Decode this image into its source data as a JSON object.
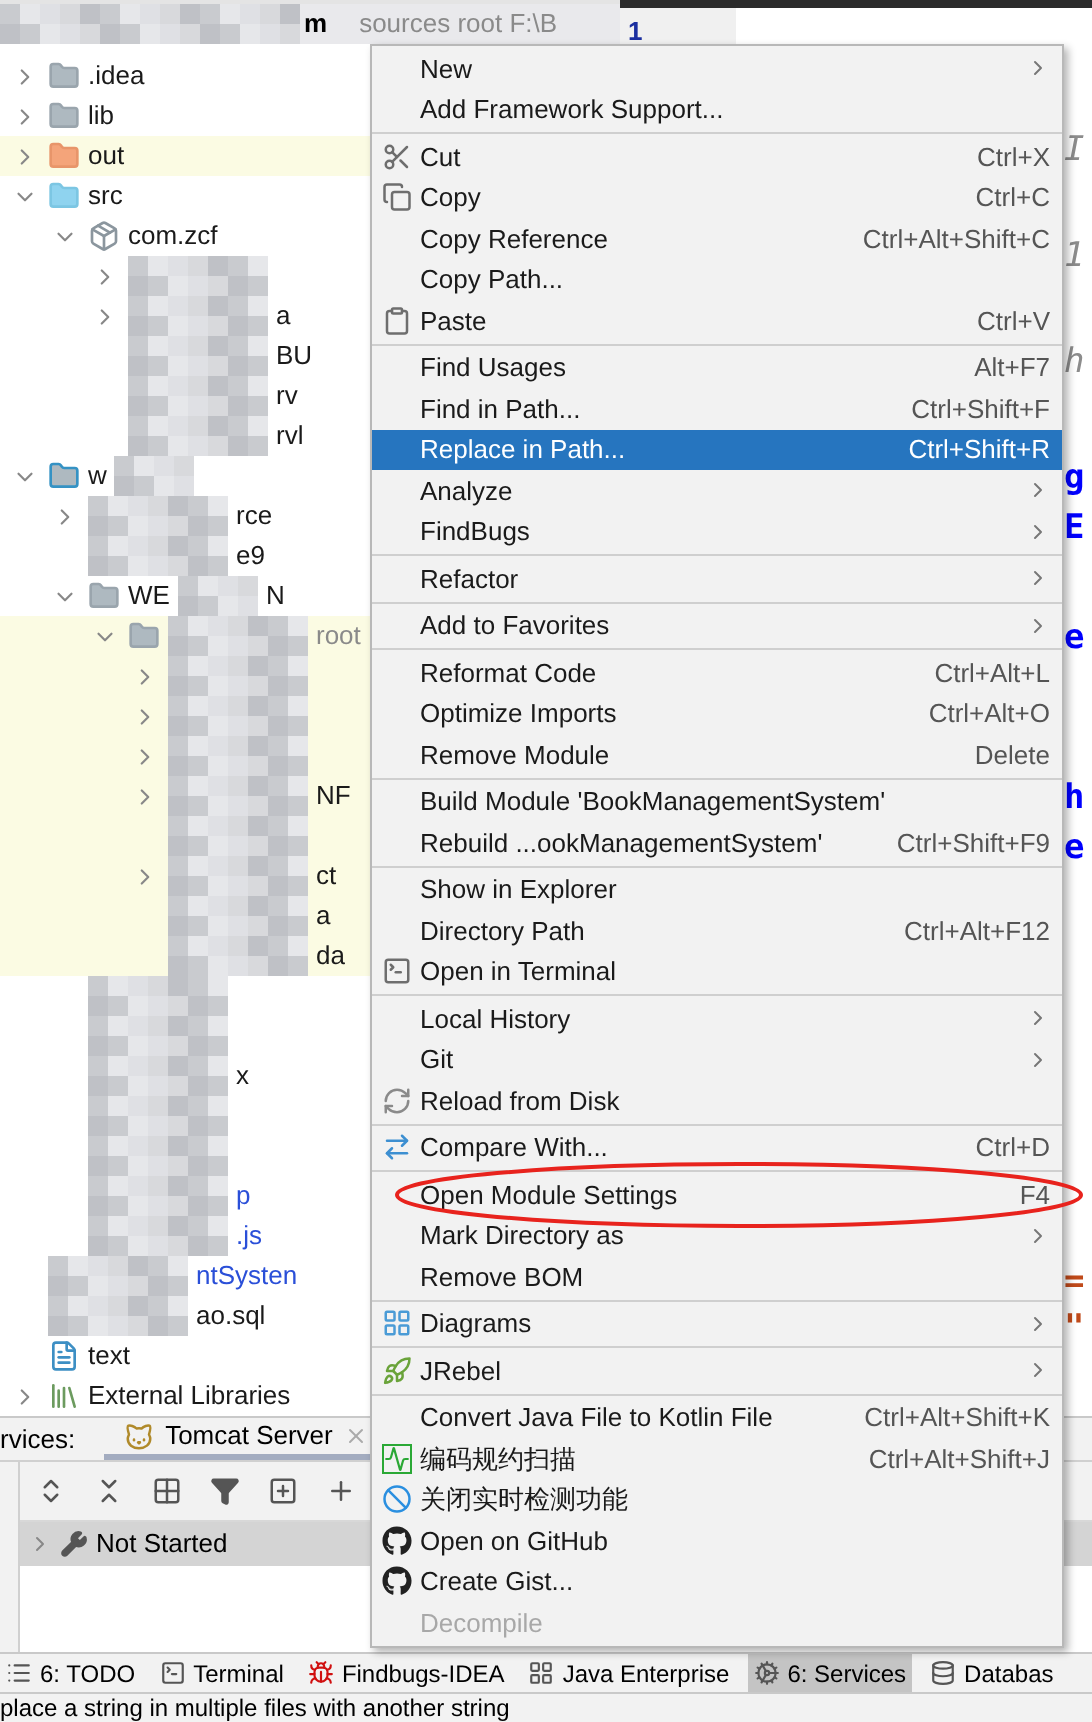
{
  "project": {
    "root_row": {
      "fragment": "m",
      "detail": "sources root F:\\B",
      "redacted": true
    },
    "tree": [
      {
        "label": ".idea",
        "kind": "folder",
        "expanded": false
      },
      {
        "label": "lib",
        "kind": "folder",
        "expanded": false
      },
      {
        "label": "out",
        "kind": "output-folder",
        "expanded": false,
        "highlight": true
      },
      {
        "label": "src",
        "kind": "source-folder",
        "expanded": true,
        "children": [
          {
            "label": "com.zcf",
            "kind": "package",
            "expanded": true,
            "children": [
              {
                "expanded": false,
                "redacted": true
              },
              {
                "expanded": false,
                "redacted": true,
                "fragment": "a"
              },
              {
                "redacted": true,
                "fragment": "BU"
              },
              {
                "redacted": true,
                "fragment": "rv"
              },
              {
                "redacted": true,
                "fragment": "rvl"
              }
            ]
          }
        ]
      },
      {
        "label": "w",
        "kind": "module",
        "expanded": true,
        "redacted": true,
        "children": [
          {
            "expanded": false,
            "redacted": true,
            "fragment": "rce"
          },
          {
            "redacted": true,
            "fragment": "e9"
          },
          {
            "label": "WE",
            "kind": "folder",
            "expanded": true,
            "redacted": true,
            "fragment": "N",
            "children": [
              {
                "kind": "folder",
                "expanded": true,
                "redacted": true,
                "fragment": "root",
                "excluded": true,
                "highlight": true,
                "children": [
                  {
                    "expanded": false,
                    "redacted": true,
                    "highlight": true
                  },
                  {
                    "expanded": false,
                    "redacted": true,
                    "highlight": true
                  },
                  {
                    "expanded": false,
                    "redacted": true,
                    "highlight": true
                  },
                  {
                    "expanded": false,
                    "redacted": true,
                    "fragment": "NF",
                    "highlight": true
                  },
                  {
                    "redacted": true,
                    "highlight": true
                  },
                  {
                    "expanded": false,
                    "redacted": true,
                    "fragment": "ct",
                    "highlight": true
                  },
                  {
                    "redacted": true,
                    "fragment": "a",
                    "highlight": true
                  },
                  {
                    "redacted": true,
                    "fragment": "da",
                    "highlight": true
                  }
                ]
              }
            ]
          },
          {
            "redacted": true
          },
          {
            "redacted": true
          },
          {
            "redacted": true,
            "fragment": "x"
          },
          {
            "redacted": true
          },
          {
            "redacted": true
          },
          {
            "redacted": true,
            "fragment": "p",
            "modified": true
          },
          {
            "redacted": true,
            "fragment": ".js",
            "modified": true
          }
        ]
      },
      {
        "redacted": true,
        "fragment": "ntSysten",
        "modified": true
      },
      {
        "redacted": true,
        "fragment": "ao.sql"
      },
      {
        "label": "text",
        "kind": "markdown"
      },
      {
        "label": "External Libraries",
        "kind": "libraries",
        "expanded": false
      }
    ]
  },
  "editor": {
    "line_number": "1",
    "fragments": [
      {
        "text": "I",
        "kind": "comment"
      },
      {
        "text": "1",
        "kind": "comment"
      },
      {
        "text": "h",
        "kind": "comment"
      },
      {
        "text": "g",
        "kind": "tag"
      },
      {
        "text": "E",
        "kind": "tag"
      },
      {
        "text": "e",
        "kind": "tag"
      },
      {
        "text": "h",
        "kind": "tag"
      },
      {
        "text": "e",
        "kind": "tag"
      },
      {
        "text": "=",
        "kind": "operator"
      },
      {
        "text": "\"",
        "kind": "operator"
      }
    ]
  },
  "context_menu": {
    "sections": [
      [
        {
          "label": "New",
          "submenu": true
        },
        {
          "label": "Add Framework Support..."
        }
      ],
      [
        {
          "label": "Cut",
          "shortcut": "Ctrl+X",
          "kind": "cut"
        },
        {
          "label": "Copy",
          "shortcut": "Ctrl+C",
          "kind": "copy"
        },
        {
          "label": "Copy Reference",
          "shortcut": "Ctrl+Alt+Shift+C"
        },
        {
          "label": "Copy Path..."
        },
        {
          "label": "Paste",
          "shortcut": "Ctrl+V",
          "kind": "paste"
        }
      ],
      [
        {
          "label": "Find Usages",
          "shortcut": "Alt+F7"
        },
        {
          "label": "Find in Path...",
          "shortcut": "Ctrl+Shift+F"
        },
        {
          "label": "Replace in Path...",
          "shortcut": "Ctrl+Shift+R",
          "selected": true
        },
        {
          "label": "Analyze",
          "submenu": true
        },
        {
          "label": "FindBugs",
          "submenu": true
        }
      ],
      [
        {
          "label": "Refactor",
          "submenu": true
        }
      ],
      [
        {
          "label": "Add to Favorites",
          "submenu": true
        }
      ],
      [
        {
          "label": "Reformat Code",
          "shortcut": "Ctrl+Alt+L"
        },
        {
          "label": "Optimize Imports",
          "shortcut": "Ctrl+Alt+O"
        },
        {
          "label": "Remove Module",
          "shortcut": "Delete"
        }
      ],
      [
        {
          "label": "Build Module 'BookManagementSystem'"
        },
        {
          "label": "Rebuild ...ookManagementSystem'",
          "shortcut": "Ctrl+Shift+F9"
        }
      ],
      [
        {
          "label": "Show in Explorer"
        },
        {
          "label": "Directory Path",
          "shortcut": "Ctrl+Alt+F12"
        },
        {
          "label": "Open in Terminal",
          "kind": "terminal"
        }
      ],
      [
        {
          "label": "Local History",
          "submenu": true
        },
        {
          "label": "Git",
          "submenu": true
        },
        {
          "label": "Reload from Disk",
          "kind": "reload"
        }
      ],
      [
        {
          "label": "Compare With...",
          "shortcut": "Ctrl+D",
          "kind": "compare"
        }
      ],
      [
        {
          "label": "Open Module Settings",
          "shortcut": "F4",
          "circled": true
        },
        {
          "label": "Mark Directory as",
          "submenu": true
        },
        {
          "label": "Remove BOM"
        }
      ],
      [
        {
          "label": "Diagrams",
          "submenu": true,
          "kind": "diagrams"
        }
      ],
      [
        {
          "label": "JRebel",
          "submenu": true,
          "kind": "jrebel"
        }
      ],
      [
        {
          "label": "Convert Java File to Kotlin File",
          "shortcut": "Ctrl+Alt+Shift+K"
        },
        {
          "label": "编码规约扫描",
          "shortcut": "Ctrl+Alt+Shift+J",
          "kind": "scan"
        },
        {
          "label": "关闭实时检测功能",
          "kind": "disable"
        },
        {
          "label": "Open on GitHub",
          "kind": "github"
        },
        {
          "label": "Create Gist...",
          "kind": "github"
        },
        {
          "label": "Decompile",
          "disabled": true
        }
      ]
    ]
  },
  "services": {
    "title": "rvices:",
    "tabs": [
      {
        "label": "Tomcat Server",
        "selected": true
      }
    ],
    "toolbar": [
      {
        "kind": "expand-all"
      },
      {
        "kind": "collapse-all"
      },
      {
        "kind": "group"
      },
      {
        "kind": "filter"
      },
      {
        "kind": "add-service"
      },
      {
        "kind": "add"
      }
    ],
    "rows": [
      {
        "label": "Not Started",
        "expanded": false,
        "selected": true
      }
    ]
  },
  "tool_windows": [
    {
      "label": "6: TODO",
      "kind": "todo",
      "selected": false
    },
    {
      "label": "Terminal",
      "kind": "terminal",
      "selected": false
    },
    {
      "label": "Findbugs-IDEA",
      "kind": "findbugs",
      "selected": false
    },
    {
      "label": "Java Enterprise",
      "kind": "javaee",
      "selected": false
    },
    {
      "label": "6: Services",
      "kind": "services",
      "selected": true
    },
    {
      "label": "Databas",
      "kind": "database",
      "selected": false
    }
  ],
  "status_bar": {
    "message": "place a string in multiple files with another string"
  }
}
